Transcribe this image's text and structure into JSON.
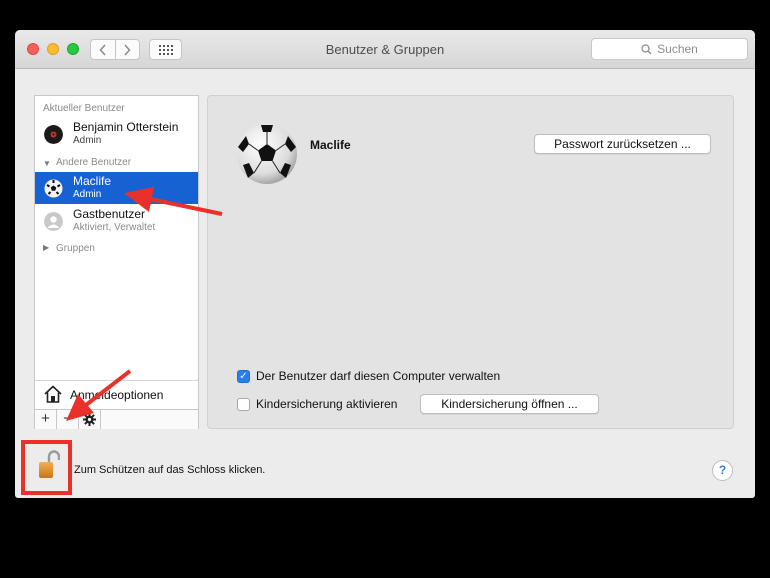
{
  "window": {
    "title": "Benutzer & Gruppen",
    "search_placeholder": "Suchen"
  },
  "sidebar": {
    "current_label": "Aktueller Benutzer",
    "current_user": {
      "name": "Benjamin Otterstein",
      "role": "Admin"
    },
    "other_label": "Andere Benutzer",
    "other_users": [
      {
        "name": "Maclife",
        "role": "Admin",
        "selected": true
      },
      {
        "name": "Gastbenutzer",
        "role": "Aktiviert, Verwaltet",
        "selected": false
      }
    ],
    "groups_label": "Gruppen",
    "login_options": "Anmeldeoptionen",
    "toolbar": {
      "add": "+",
      "remove": "−"
    }
  },
  "panel": {
    "user_name": "Maclife",
    "reset_password": "Passwort zurücksetzen ...",
    "allow_admin_label": "Der Benutzer darf diesen Computer verwalten",
    "allow_admin_checked": true,
    "parental_label": "Kindersicherung aktivieren",
    "parental_checked": false,
    "open_parental": "Kindersicherung öffnen ..."
  },
  "footer": {
    "lock_text": "Zum Schützen auf das Schloss klicken.",
    "help": "?"
  },
  "colors": {
    "selection": "#1762d3",
    "annotation_red": "#e9302a"
  }
}
